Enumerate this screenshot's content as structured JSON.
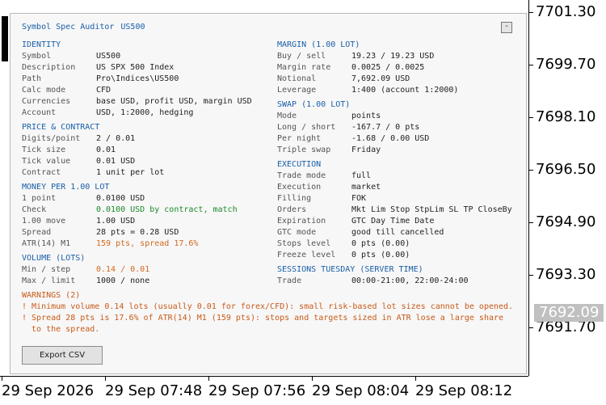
{
  "chart": {
    "price_labels": [
      "7701.30",
      "7699.70",
      "7698.10",
      "7696.50",
      "7694.90",
      "7693.30",
      "7691.70"
    ],
    "current_price": "7692.09",
    "time_labels": [
      "29 Sep 2026",
      "29 Sep 07:48",
      "29 Sep 07:56",
      "29 Sep 08:04",
      "29 Sep 08:12"
    ]
  },
  "panel": {
    "title": "Symbol Spec Auditor",
    "symbol": "US500",
    "minimize_label": "-",
    "export_label": "Export CSV"
  },
  "identity": {
    "header": "IDENTITY",
    "rows": [
      {
        "k": "Symbol",
        "v": "US500"
      },
      {
        "k": "Description",
        "v": "US SPX 500 Index"
      },
      {
        "k": "Path",
        "v": "Pro\\Indices\\US500"
      },
      {
        "k": "Calc mode",
        "v": "CFD"
      },
      {
        "k": "Currencies",
        "v": "base USD, profit USD, margin USD"
      },
      {
        "k": "Account",
        "v": "USD, 1:2000, hedging"
      }
    ]
  },
  "price_contract": {
    "header": "PRICE & CONTRACT",
    "rows": [
      {
        "k": "Digits/point",
        "v": "2 / 0.01"
      },
      {
        "k": "Tick size",
        "v": "0.01"
      },
      {
        "k": "Tick value",
        "v": "0.01 USD"
      },
      {
        "k": "Contract",
        "v": "1 unit per lot"
      }
    ]
  },
  "money": {
    "header": "MONEY PER 1.00 LOT",
    "rows": [
      {
        "k": "1 point",
        "v": "0.0100 USD"
      },
      {
        "k": "Check",
        "v": "0.0100 USD by contract, match"
      },
      {
        "k": "1.00 move",
        "v": "1.00 USD"
      },
      {
        "k": "Spread",
        "v": "28 pts = 0.28 USD"
      },
      {
        "k": "ATR(14) M1",
        "v": "159 pts, spread 17.6%"
      }
    ]
  },
  "volume": {
    "header": "VOLUME (LOTS)",
    "rows": [
      {
        "k": "Min / step",
        "v": "0.14 / 0.01"
      },
      {
        "k": "Max / limit",
        "v": "1000 / none"
      }
    ]
  },
  "margin": {
    "header": "MARGIN (1.00 LOT)",
    "rows": [
      {
        "k": "Buy / sell",
        "v": "19.23 / 19.23 USD"
      },
      {
        "k": "Margin rate",
        "v": "0.0025 / 0.0025"
      },
      {
        "k": "Notional",
        "v": "7,692.09 USD"
      },
      {
        "k": "Leverage",
        "v": "1:400 (account 1:2000)"
      }
    ]
  },
  "swap": {
    "header": "SWAP (1.00 LOT)",
    "rows": [
      {
        "k": "Mode",
        "v": "points"
      },
      {
        "k": "Long / short",
        "v": "-167.7 / 0 pts"
      },
      {
        "k": "Per night",
        "v": "-1.68 / 0.00 USD"
      },
      {
        "k": "Triple swap",
        "v": "Friday"
      }
    ]
  },
  "execution": {
    "header": "EXECUTION",
    "rows": [
      {
        "k": "Trade mode",
        "v": "full"
      },
      {
        "k": "Execution",
        "v": "market"
      },
      {
        "k": "Filling",
        "v": "FOK"
      },
      {
        "k": "Orders",
        "v": "Mkt Lim Stop StpLim SL TP CloseBy"
      },
      {
        "k": "Expiration",
        "v": "GTC Day Time Date"
      },
      {
        "k": "GTC mode",
        "v": "good till cancelled"
      },
      {
        "k": "Stops level",
        "v": "0 pts (0.00)"
      },
      {
        "k": "Freeze level",
        "v": "0 pts (0.00)"
      }
    ]
  },
  "sessions": {
    "header": "SESSIONS TUESDAY (SERVER TIME)",
    "rows": [
      {
        "k": "Trade",
        "v": "00:00-21:00, 22:00-24:00"
      }
    ]
  },
  "warnings": {
    "header": "WARNINGS (2)",
    "lines": [
      "! Minimum volume 0.14 lots (usually 0.01 for forex/CFD): small risk-based lot sizes cannot be opened.",
      "! Spread 28 pts is 17.6% of ATR(14) M1 (159 pts): stops and targets sized in ATR lose a large share",
      "  to the spread."
    ]
  },
  "colors": {
    "accent": "#1a5fa8",
    "ok": "#1a8a2a",
    "warn": "#d2691e"
  }
}
